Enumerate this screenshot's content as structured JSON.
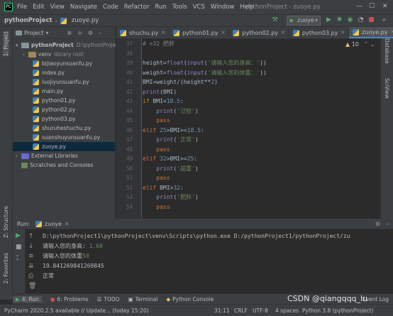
{
  "menubar": {
    "items": [
      "File",
      "Edit",
      "View",
      "Navigate",
      "Code",
      "Refactor",
      "Run",
      "Tools",
      "VCS",
      "Window",
      "Help"
    ],
    "window_title": "pythonProject - zuoye.py"
  },
  "navbar": {
    "project": "pythonProject",
    "file": "zuoye.py"
  },
  "run_config": "zuoye",
  "tool_windows": {
    "left_project": "1: Project",
    "left_structure": "Z: Structure",
    "left_favorites": "2: Favorites",
    "right_database": "Database",
    "right_sciview": "SciView"
  },
  "project_panel": {
    "header": "Project",
    "root_name": "pythonProject",
    "root_path": "D:\\pythonProject",
    "items": [
      {
        "label": "venv",
        "suffix": "library root",
        "kind": "folder"
      },
      {
        "label": "bijiaoyunsuanfu.py",
        "kind": "py"
      },
      {
        "label": "index.py",
        "kind": "py"
      },
      {
        "label": "luojiyunsuanfu.py",
        "kind": "py"
      },
      {
        "label": "main.py",
        "kind": "py"
      },
      {
        "label": "python01.py",
        "kind": "py"
      },
      {
        "label": "python02.py",
        "kind": "py"
      },
      {
        "label": "python03.py",
        "kind": "py"
      },
      {
        "label": "shuruheshuchu.py",
        "kind": "py"
      },
      {
        "label": "suanshuyunsuanfu.py",
        "kind": "py"
      },
      {
        "label": "zuoye.py",
        "kind": "py",
        "selected": true
      }
    ],
    "external": "External Libraries",
    "scratches": "Scratches and Consoles"
  },
  "editor": {
    "tabs": [
      "shuchu.py",
      "python01.py",
      "python02.py",
      "python03.py",
      "zuoye.py"
    ],
    "active_tab": 4,
    "warning_count": "10",
    "line_numbers": [
      "37",
      "38",
      "39",
      "40",
      "41",
      "42",
      "43",
      "44",
      "45",
      "46",
      "47",
      "48",
      "49",
      "50",
      "51",
      "52",
      "53",
      "54"
    ],
    "code_top": "# >32 肥胖"
  },
  "run": {
    "label": "Run:",
    "config": "zuoye",
    "command": "D:\\pythonProject1\\pythonProject\\venv\\Scripts\\python.exe D:/pythonProject1/pythonProject/zu",
    "prompt_height": "请输入您的身高: ",
    "height_val": "1.60",
    "prompt_weight": "请输入您的体重",
    "weight_val": "50",
    "bmi": "19.841269841269845",
    "result": "正常"
  },
  "bottom_tabs": [
    "4: Run",
    "6: Problems",
    "TODO",
    "Terminal",
    "Python Console"
  ],
  "event_log": "Event Log",
  "status": {
    "message": "PyCharm 2020.2.5 available // Update... (today 15:20)",
    "position": "31:11",
    "line_sep": "CRLF",
    "encoding": "UTF-8",
    "indent": "4 spaces",
    "interpreter": "Python 3.8 (pythonProject)"
  },
  "watermark": "CSDN @qiangqqq_lu"
}
